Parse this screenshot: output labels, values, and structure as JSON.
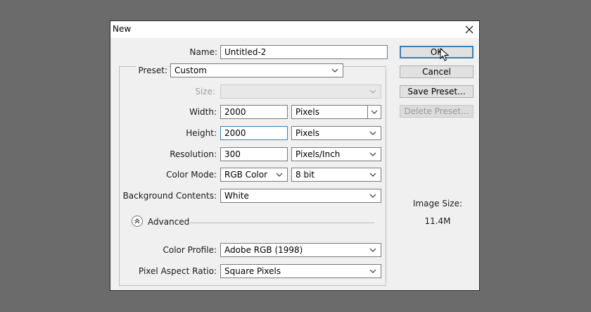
{
  "dialog": {
    "title": "New",
    "close_glyph": "✕"
  },
  "form": {
    "name_label": "Name:",
    "name_value": "Untitled-2",
    "preset_label": "Preset:",
    "preset_value": "Custom",
    "size_label": "Size:",
    "size_value": "",
    "width_label": "Width:",
    "width_value": "2000",
    "width_unit": "Pixels",
    "height_label": "Height:",
    "height_value": "2000",
    "height_unit": "Pixels",
    "resolution_label": "Resolution:",
    "resolution_value": "300",
    "resolution_unit": "Pixels/Inch",
    "color_mode_label": "Color Mode:",
    "color_mode_value": "RGB Color",
    "bit_depth_value": "8 bit",
    "background_label": "Background Contents:",
    "background_value": "White",
    "advanced_label": "Advanced",
    "color_profile_label": "Color Profile:",
    "color_profile_value": "Adobe RGB (1998)",
    "pixel_aspect_label": "Pixel Aspect Ratio:",
    "pixel_aspect_value": "Square Pixels"
  },
  "buttons": {
    "ok": "OK",
    "cancel": "Cancel",
    "save_preset": "Save Preset...",
    "delete_preset": "Delete Preset..."
  },
  "info": {
    "image_size_label": "Image Size:",
    "image_size_value": "11.4M"
  },
  "icons": {
    "close": "close-icon",
    "chevron": "chevron-down-icon",
    "advanced_toggle": "double-chevron-up-icon",
    "cursor": "mouse-pointer-icon"
  },
  "colors": {
    "focus_border": "#3c7fb1",
    "backdrop": "#6b6b6b",
    "dialog_bg": "#f0f0f0"
  }
}
